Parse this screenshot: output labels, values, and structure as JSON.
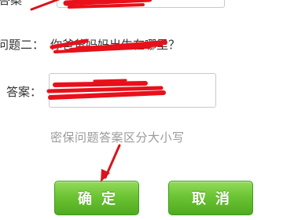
{
  "form": {
    "answer1_label": "答案",
    "question2_label": "问题二：",
    "question2_text": "你爸爸妈妈出生在哪里？",
    "answer2_label": "答案：",
    "hint": "密保问题答案区分大小写"
  },
  "buttons": {
    "confirm_label": "确定",
    "cancel_label": "取消"
  },
  "colors": {
    "button_green": "#6cc433",
    "scribble_red": "#e8101a",
    "arrow_red": "#d8141c"
  },
  "icons": {
    "annotation": "arrow-annotation-icon"
  }
}
